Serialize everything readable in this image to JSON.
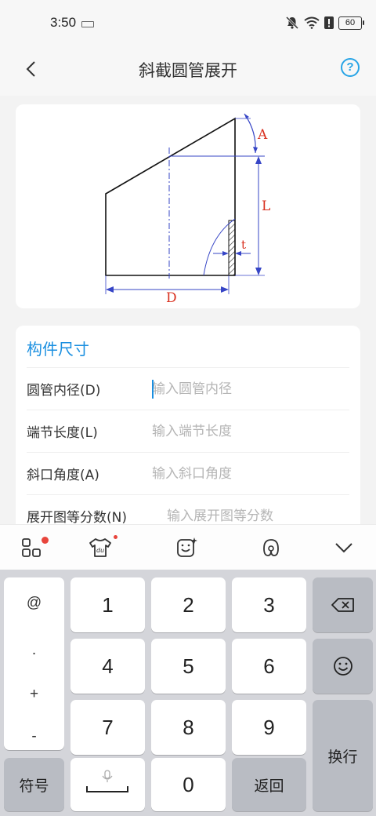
{
  "status_bar": {
    "time": "3:50",
    "battery": "60"
  },
  "header": {
    "title": "斜截圆管展开",
    "help": "?"
  },
  "diagram": {
    "label_a": "A",
    "label_l": "L",
    "label_t": "t",
    "label_d": "D"
  },
  "form": {
    "section_title": "构件尺寸",
    "fields": [
      {
        "label": "圆管内径(D)",
        "placeholder": "输入圆管内径"
      },
      {
        "label": "端节长度(L)",
        "placeholder": "输入端节长度"
      },
      {
        "label": "斜口角度(A)",
        "placeholder": "输入斜口角度"
      },
      {
        "label": "展开图等分数(N)",
        "placeholder": "输入展开图等分数"
      }
    ]
  },
  "keyboard": {
    "symbols": [
      "@",
      ".",
      "+",
      "-"
    ],
    "digits": [
      "1",
      "2",
      "3",
      "4",
      "5",
      "6",
      "7",
      "8",
      "9",
      "0"
    ],
    "symbol_key": "符号",
    "return_key": "返回",
    "enter_key": "换行",
    "toolbar_icons": [
      "grid-menu-icon",
      "skin-icon",
      "sticker-icon",
      "handwriting-icon",
      "collapse-icon"
    ]
  },
  "colors": {
    "accent": "#1a8fe0",
    "diagram_red": "#d9301f",
    "diagram_blue": "#2e3fc7"
  }
}
